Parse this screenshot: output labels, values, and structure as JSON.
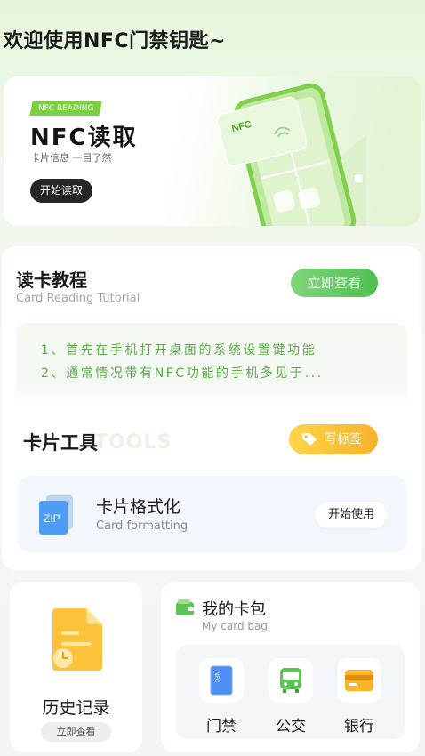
{
  "welcome": "欢迎使用NFC门禁钥匙~",
  "banner": {
    "tag": "NFC READING",
    "title": "NFC读取",
    "subtitle": "卡片信息 一目了然",
    "button": "开始读取",
    "phone_text": "NFC"
  },
  "tutorial": {
    "title": "读卡教程",
    "subtitle": "Card Reading Tutorial",
    "button": "立即查看",
    "lines": [
      "1、首先在手机打开桌面的系统设置键功能",
      "2、通常情况带有NFC功能的手机多见于..."
    ]
  },
  "tools": {
    "title": "卡片工具",
    "bg_text": "TOOLS",
    "button": "写标签",
    "format": {
      "title": "卡片格式化",
      "subtitle": "Card formatting",
      "button": "开始使用",
      "icon_text": "ZIP"
    }
  },
  "history": {
    "title": "历史记录",
    "button": "立即查看"
  },
  "wallet": {
    "title": "我的卡包",
    "subtitle": "My card bag",
    "items": [
      {
        "label": "门禁",
        "icon": "access-card-icon",
        "icon_text": "NFC"
      },
      {
        "label": "公交",
        "icon": "bus-icon"
      },
      {
        "label": "银行",
        "icon": "bank-card-icon"
      }
    ]
  },
  "colors": {
    "accent_green": "#4fbf52",
    "accent_yellow": "#f8b12a",
    "dark": "#262626"
  }
}
